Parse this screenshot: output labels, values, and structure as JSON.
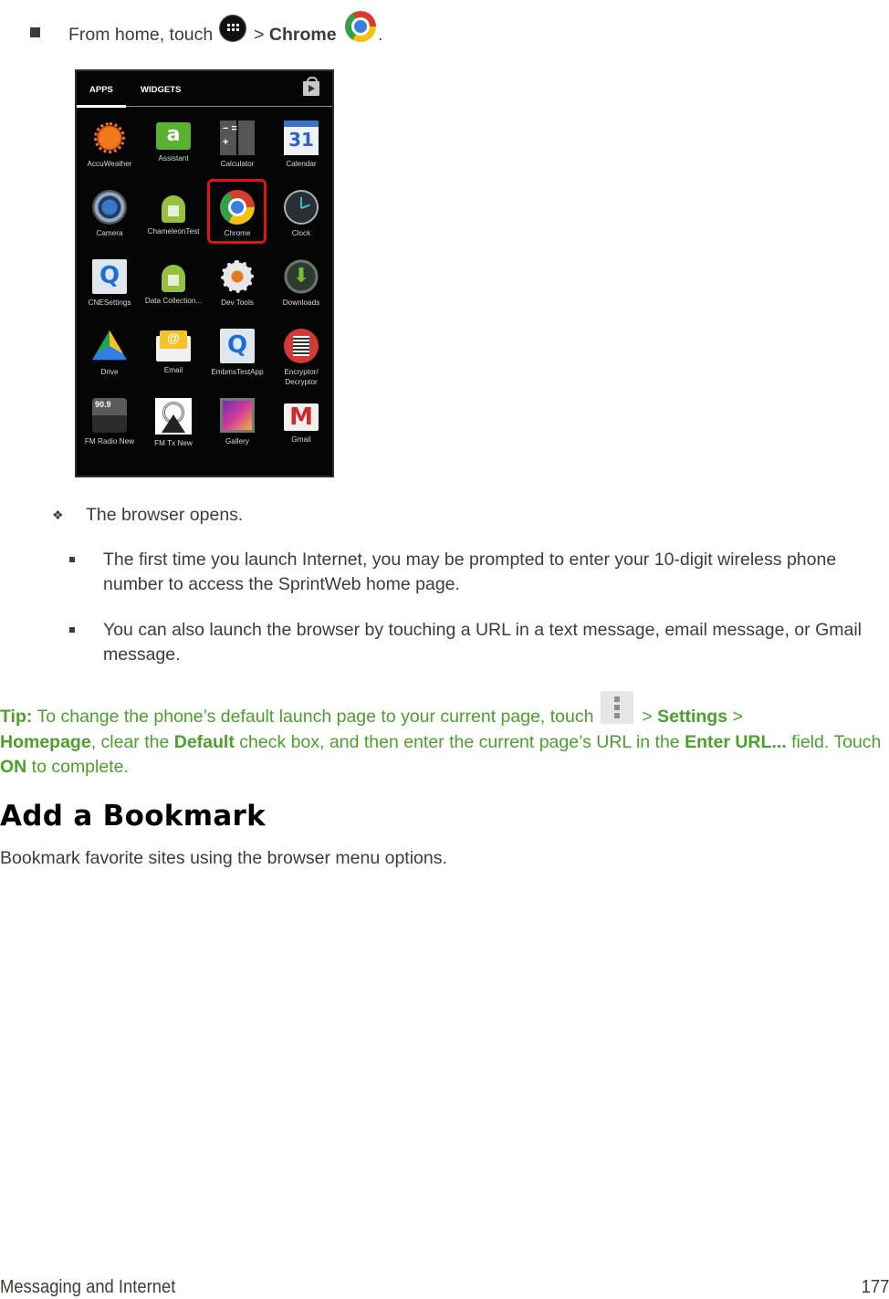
{
  "step1": {
    "prefix": "From home, touch",
    "apps_icon": "apps-launcher-icon",
    "separator": ">",
    "target_label": "Chrome",
    "target_icon": "chrome-icon",
    "suffix": "."
  },
  "phone_screen": {
    "tabs": [
      {
        "label": "APPS",
        "active": true
      },
      {
        "label": "WIDGETS",
        "active": false
      }
    ],
    "store_icon": "play-store-icon",
    "apps": [
      {
        "label": "AccuWeather",
        "icon": "sun-icon"
      },
      {
        "label": "Assistant",
        "icon": "assistant-icon"
      },
      {
        "label": "Calculator",
        "icon": "calculator-icon"
      },
      {
        "label": "Calendar",
        "icon": "calendar-icon"
      },
      {
        "label": "Camera",
        "icon": "camera-icon"
      },
      {
        "label": "ChameleonTest",
        "icon": "android-icon"
      },
      {
        "label": "Chrome",
        "icon": "chrome-icon",
        "highlighted": true
      },
      {
        "label": "Clock",
        "icon": "clock-icon"
      },
      {
        "label": "CNESettings",
        "icon": "qualcomm-icon"
      },
      {
        "label": "Data Collection...",
        "icon": "android-icon"
      },
      {
        "label": "Dev Tools",
        "icon": "gear-icon"
      },
      {
        "label": "Downloads",
        "icon": "download-icon"
      },
      {
        "label": "Drive",
        "icon": "drive-icon"
      },
      {
        "label": "Email",
        "icon": "email-icon"
      },
      {
        "label": "EmbmsTestApp",
        "icon": "qualcomm-icon"
      },
      {
        "label": "Encryptor/ Decryptor",
        "icon": "encryptor-icon"
      },
      {
        "label": "FM Radio New",
        "icon": "radio-icon"
      },
      {
        "label": "FM Tx New",
        "icon": "transmitter-icon"
      },
      {
        "label": "Gallery",
        "icon": "gallery-icon"
      },
      {
        "label": "Gmail",
        "icon": "gmail-icon"
      }
    ],
    "highlight_color": "#e0131c"
  },
  "result": "The browser opens.",
  "notes": [
    "The first time you launch Internet, you may be prompted to enter your 10-digit wireless phone number to access the SprintWeb home page.",
    "You can also launch the browser by touching a URL in a text message, email message, or Gmail message."
  ],
  "tip": {
    "label": "Tip:",
    "t1": " To change the phone’s default launch page to your current page, touch ",
    "menu_icon": "overflow-menu-icon",
    "t2": " > ",
    "settings": "Settings",
    "t3": " > ",
    "homepage": "Homepage",
    "t4": ", clear the ",
    "default": "Default",
    "t5": " check box, and then enter the current page’s URL in the ",
    "enter_url": "Enter URL...",
    "t6": " field. Touch ",
    "on": "ON",
    "t7": " to complete.",
    "color": "#4aa02a"
  },
  "section": {
    "heading": "Add a Bookmark",
    "intro": "Bookmark favorite sites using the browser menu options."
  },
  "footer": {
    "chapter": "Messaging and Internet",
    "page": "177"
  }
}
